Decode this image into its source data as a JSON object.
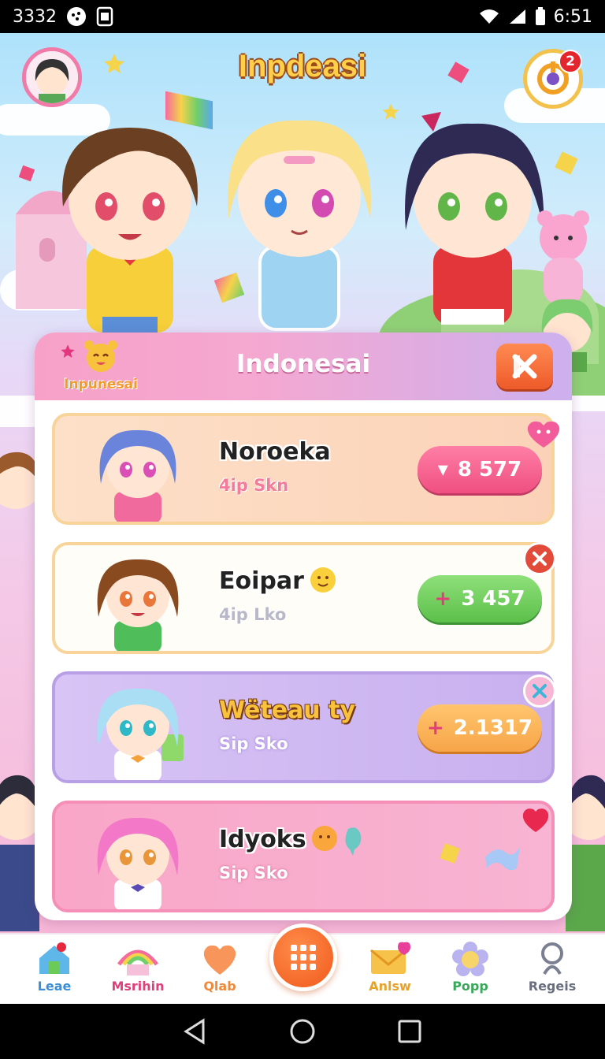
{
  "status_bar": {
    "left_text": "3332",
    "time": "6:51",
    "icons": [
      "notification-dot-icon",
      "sim-icon",
      "wifi-icon",
      "signal-icon",
      "battery-icon"
    ]
  },
  "header": {
    "app_title": "Inpdeasi",
    "notification_count": "2"
  },
  "panel": {
    "logo_text": "Inpunesai",
    "title": "Indonesai",
    "cards": [
      {
        "name": "Noroeka",
        "sub": "4ip Skn",
        "value": "8 577",
        "pill_icon": "▾",
        "accent": "#f4648f"
      },
      {
        "name": "Eoipar",
        "sub": "4ip Lko",
        "value": "3 457",
        "pill_icon": "+",
        "accent": "#6ccb58"
      },
      {
        "name": "Wëteau ty",
        "sub": "Sip Sko",
        "value": "2.1317",
        "pill_icon": "+",
        "accent": "#f7a548"
      },
      {
        "name": "Idyoks",
        "sub": "Sip Sko",
        "value": "",
        "pill_icon": "",
        "accent": "#f58fb8"
      }
    ]
  },
  "bottom_nav": {
    "items": [
      {
        "label": "Leae",
        "color": "#3c8fd6"
      },
      {
        "label": "Msrihin",
        "color": "#e0407a"
      },
      {
        "label": "Qlab",
        "color": "#f08a3a"
      },
      {
        "label": "Anlsw",
        "color": "#e8a22a"
      },
      {
        "label": "Popp",
        "color": "#3aa85a"
      },
      {
        "label": "Regeis",
        "color": "#6a6f80"
      }
    ]
  },
  "colors": {
    "accent_pink": "#f7a1c8",
    "accent_orange": "#f05a1c",
    "title_yellow": "#ffcf4a"
  }
}
